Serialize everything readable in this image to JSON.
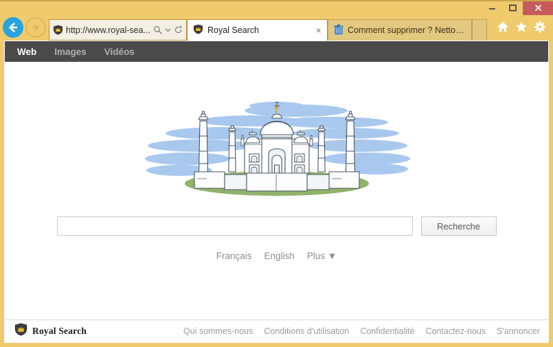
{
  "browser": {
    "window_controls": {
      "minimize_label": "Minimize",
      "maximize_label": "Maximize",
      "close_label": "Close"
    },
    "back_label": "Back",
    "forward_label": "Forward",
    "address": {
      "url": "http://www.royal-sea...",
      "favicon": "royal-shield-icon",
      "search_icon": "search-icon",
      "dropdown_icon": "chevron-down-icon",
      "refresh_icon": "refresh-icon"
    },
    "tabs": [
      {
        "title": "Royal Search",
        "favicon": "royal-shield-icon",
        "active": true,
        "close_label": "×"
      },
      {
        "title": "Comment supprimer ? Nettoy...",
        "favicon": "trash-bin-icon",
        "active": false
      }
    ],
    "toolbar_icons": [
      "home-icon",
      "favorites-star-icon",
      "settings-gear-icon"
    ],
    "colors": {
      "chrome": "#efcb6d",
      "chrome_border": "#c9a44c",
      "close_button": "#c75b5b",
      "back_button": "#27a3e0"
    }
  },
  "site": {
    "nav": [
      {
        "label": "Web",
        "selected": true
      },
      {
        "label": "Images",
        "selected": false
      },
      {
        "label": "Vidéos",
        "selected": false
      }
    ],
    "hero": {
      "name": "taj-mahal-illustration",
      "sky_color": "#a8c8ee",
      "grass_color": "#8fb36a",
      "building_color": "#ffffff",
      "outline_color": "#4a5560",
      "finial_color": "#e0a92a"
    },
    "search": {
      "value": "",
      "placeholder": "",
      "button_label": "Recherche"
    },
    "languages": [
      {
        "label": "Français"
      },
      {
        "label": "English"
      },
      {
        "label": "Plus ▼"
      }
    ],
    "footer": {
      "brand": "Royal Search",
      "brand_icon": "royal-shield-crown-icon",
      "links": [
        {
          "label": "Qui sommes-nous"
        },
        {
          "label": "Conditions d'utilisation"
        },
        {
          "label": "Confidentialité"
        },
        {
          "label": "Contactez-nous"
        },
        {
          "label": "S'annoncer"
        }
      ]
    },
    "colors": {
      "navbar": "#4a4a4a",
      "muted_text": "#9a9a9a",
      "page_bg": "#ffffff"
    }
  }
}
